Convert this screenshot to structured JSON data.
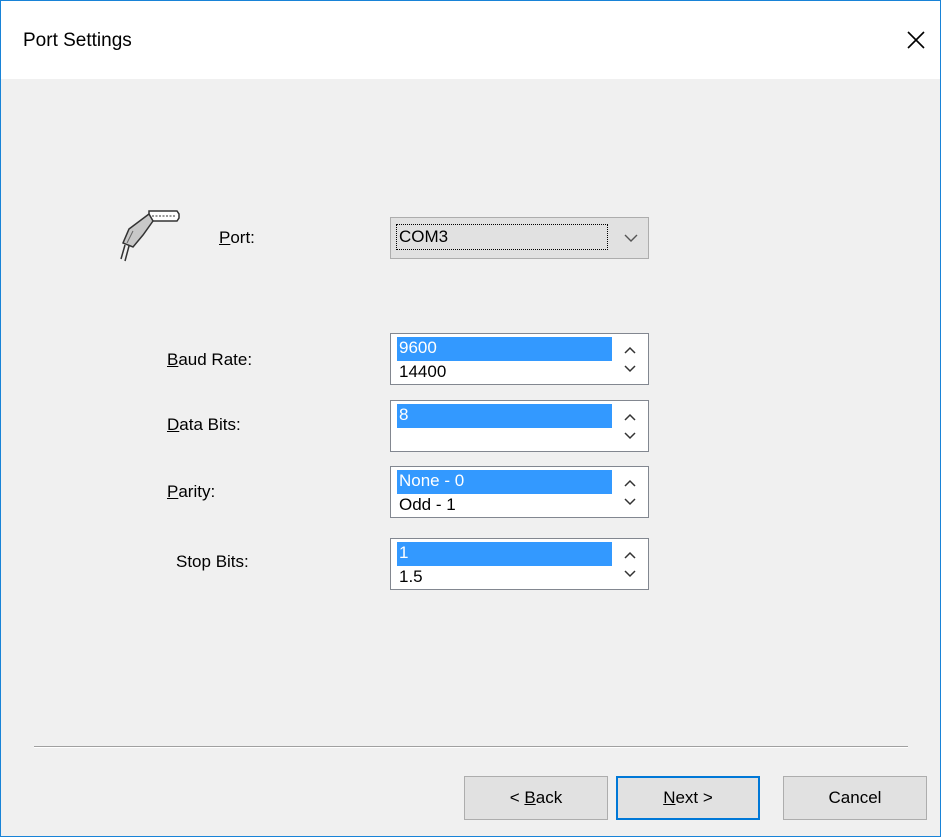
{
  "window": {
    "title": "Port Settings"
  },
  "port": {
    "label_prefix": "",
    "label_mnemonic": "P",
    "label_rest": "ort:",
    "value": "COM3"
  },
  "baud_rate": {
    "label_mnemonic": "B",
    "label_rest": "aud Rate:",
    "options": [
      "9600",
      "14400"
    ],
    "selected": "9600"
  },
  "data_bits": {
    "label_mnemonic": "D",
    "label_rest": "ata Bits:",
    "options": [
      "8"
    ],
    "selected": "8"
  },
  "parity": {
    "label_mnemonic": "P",
    "label_rest": "arity:",
    "options": [
      "None - 0",
      "Odd - 1"
    ],
    "selected": "None - 0"
  },
  "stop_bits": {
    "label": "Stop Bits:",
    "options": [
      "1",
      "1.5"
    ],
    "selected": "1"
  },
  "buttons": {
    "back_prefix": "< ",
    "back_mnemonic": "B",
    "back_rest": "ack",
    "next_mnemonic": "N",
    "next_rest": "ext >",
    "cancel": "Cancel"
  },
  "icons": {
    "port": "serial-connector-icon",
    "close": "close-icon",
    "dropdown": "chevron-down-icon",
    "spin_up": "chevron-up-icon",
    "spin_down": "chevron-down-icon"
  },
  "colors": {
    "selection": "#3399ff",
    "accent": "#0078d7",
    "dialog_bg": "#f0f0f0"
  }
}
